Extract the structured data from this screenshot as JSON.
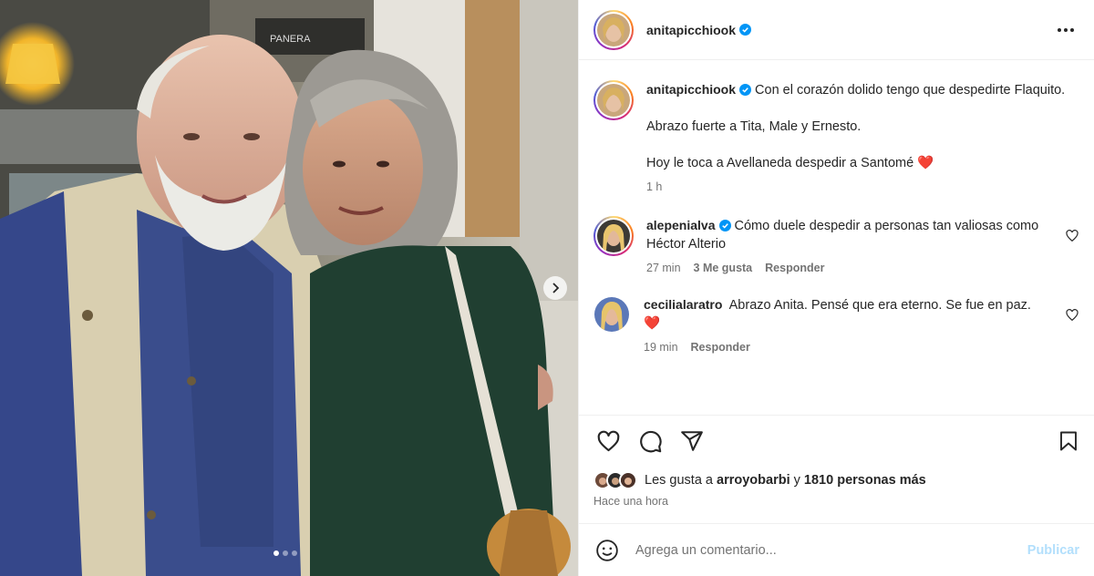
{
  "post": {
    "author": "anitapicchiook",
    "carousel": {
      "total_slides": 3,
      "current_slide": 1
    },
    "photo": {
      "sign_text": "PANERA"
    }
  },
  "caption": {
    "username": "anitapicchiook",
    "line1": "Con el corazón dolido tengo que despedirte Flaquito.",
    "line2": "Abrazo fuerte a Tita, Male y Ernesto.",
    "line3": "Hoy le toca a Avellaneda despedir a Santomé",
    "heart_emoji": "❤️",
    "time": "1 h"
  },
  "comments": [
    {
      "username": "alepenialva",
      "verified": true,
      "text": "Cómo duele despedir a personas tan valiosas como Héctor Alterio",
      "time": "27 min",
      "likes": "3 Me gusta",
      "reply": "Responder"
    },
    {
      "username": "cecilialaratro",
      "verified": false,
      "text": "Abrazo Anita. Pensé que era eterno. Se fue en paz.",
      "heart_emoji": "❤️",
      "time": "19 min",
      "reply": "Responder"
    }
  ],
  "likes": {
    "prefix": "Les gusta a",
    "first_user": "arroyobarbi",
    "conj": "y",
    "others": "1810 personas más",
    "time_ago": "Hace una hora"
  },
  "composer": {
    "placeholder": "Agrega un comentario...",
    "publish_label": "Publicar"
  },
  "colors": {
    "verified": "#0095f6",
    "heart": "#e0162b",
    "publish_disabled": "#b2dffc"
  },
  "icons": [
    "like-icon",
    "comment-icon",
    "share-icon",
    "save-icon",
    "more-options-icon",
    "emoji-icon",
    "verified-badge-icon",
    "chevron-right-icon"
  ]
}
